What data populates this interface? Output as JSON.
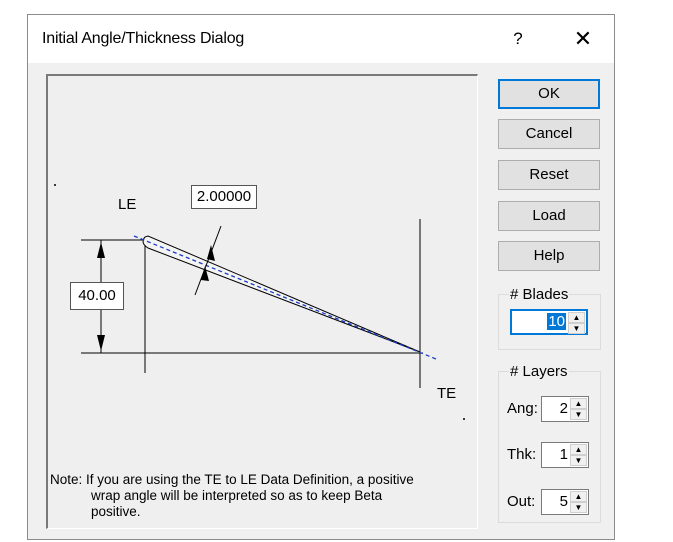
{
  "dialog": {
    "title": "Initial Angle/Thickness Dialog",
    "help_glyph": "?",
    "close_glyph": "✕"
  },
  "diagram": {
    "le_label": "LE",
    "te_label": "TE",
    "thickness_value": "2.00000",
    "height_value": "40.00",
    "note_line1": "Note: If you are using the TE to LE Data Definition, a positive",
    "note_line2": "wrap angle will be interpreted so as to keep Beta",
    "note_line3": "positive."
  },
  "buttons": {
    "ok": "OK",
    "cancel": "Cancel",
    "reset": "Reset",
    "load": "Load",
    "help": "Help"
  },
  "blades": {
    "title": "# Blades",
    "value": "10"
  },
  "layers": {
    "title": "# Layers",
    "ang_label": "Ang:",
    "ang_value": "2",
    "thk_label": "Thk:",
    "thk_value": "1",
    "out_label": "Out:",
    "out_value": "5"
  },
  "icons": {
    "spin_up": "▲",
    "spin_down": "▼"
  },
  "colors": {
    "accent": "#0078d7",
    "dialog_bg": "#f0f0f0",
    "blade_line": "#1a3cc8"
  }
}
